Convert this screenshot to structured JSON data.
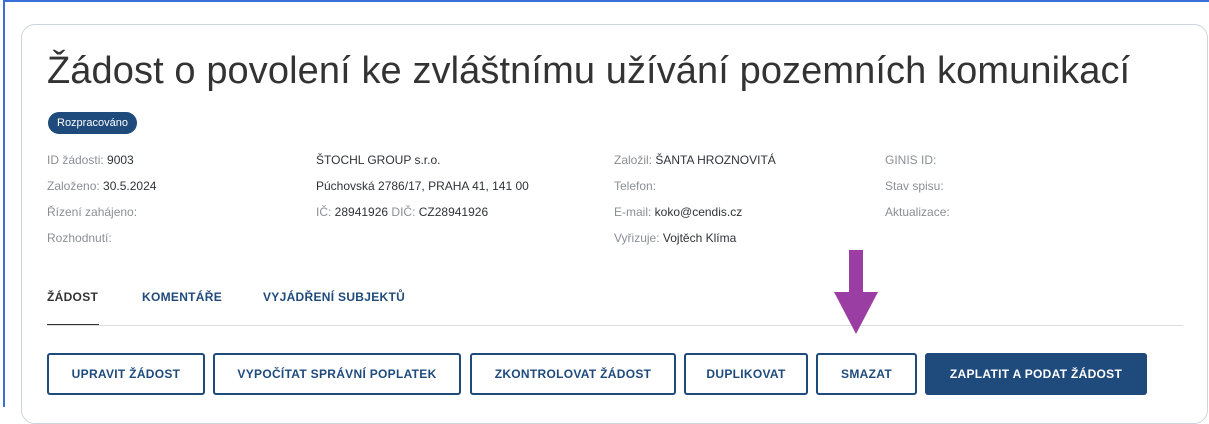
{
  "header": {
    "title": "Žádost o povolení ke zvláštnímu užívání pozemních komunikací",
    "status_badge": "Rozpracováno"
  },
  "info": {
    "col1": [
      {
        "label": "ID žádosti: ",
        "value": "9003"
      },
      {
        "label": "Založeno: ",
        "value": "30.5.2024"
      },
      {
        "label": "Řízení zahájeno:",
        "value": ""
      },
      {
        "label": "Rozhodnutí:",
        "value": ""
      }
    ],
    "col2": {
      "company": "ŠTOCHL GROUP s.r.o.",
      "address": "Púchovská 2786/17, PRAHA 41, 141 00",
      "ico_label": "IČ: ",
      "ico": "28941926",
      "dic_label": " DIČ: ",
      "dic": "CZ28941926"
    },
    "col3": [
      {
        "label": "Založil: ",
        "value": "ŠANTA HROZNOVITÁ"
      },
      {
        "label": "Telefon:",
        "value": ""
      },
      {
        "label": "E-mail: ",
        "value": "koko@cendis.cz"
      },
      {
        "label": "Vyřizuje: ",
        "value": "Vojtěch Klíma"
      }
    ],
    "col4": [
      "GINIS ID:",
      "Stav spisu:",
      "Aktualizace:"
    ]
  },
  "tabs": [
    {
      "label": "ŽÁDOST",
      "active": true
    },
    {
      "label": "KOMENTÁŘE",
      "active": false
    },
    {
      "label": "VYJÁDŘENÍ SUBJEKTŮ",
      "active": false
    }
  ],
  "actions": {
    "edit": "UPRAVIT ŽÁDOST",
    "calc_fee": "VYPOČÍTAT SPRÁVNÍ POPLATEK",
    "check": "ZKONTROLOVAT ŽÁDOST",
    "duplicate": "DUPLIKOVAT",
    "delete": "SMAZAT",
    "pay_submit": "ZAPLATIT A PODAT ŽÁDOST"
  },
  "colors": {
    "primary": "#1f4a7c",
    "frame_border": "#3a6fd8",
    "annotation_arrow": "#9b3ea3"
  },
  "icons": {
    "annotation": "down-arrow-icon"
  }
}
